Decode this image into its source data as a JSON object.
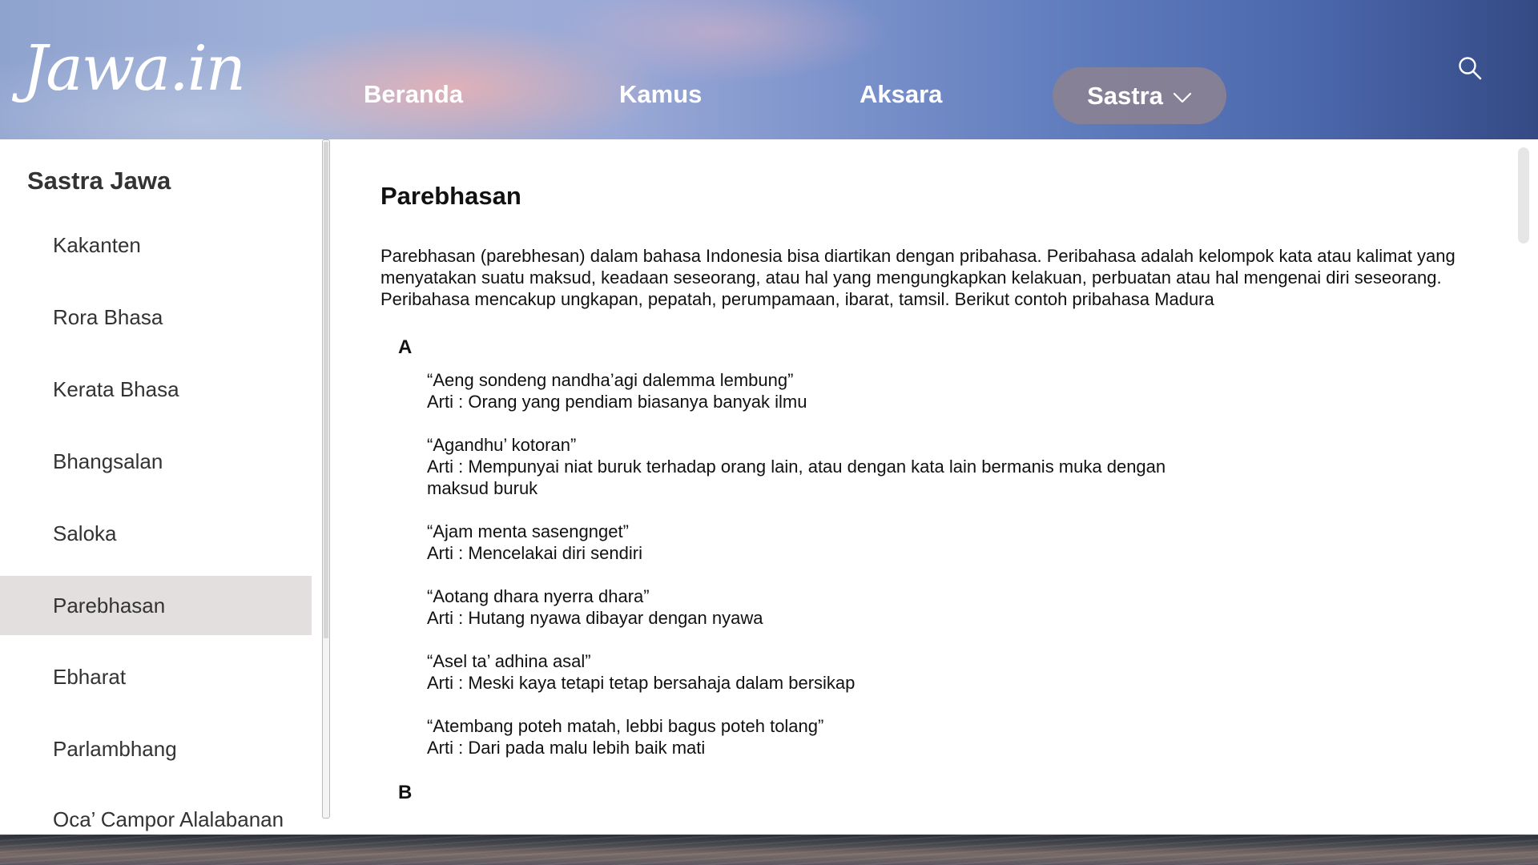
{
  "header": {
    "logo_text": "Jawa.in",
    "nav": {
      "beranda": "Beranda",
      "kamus": "Kamus",
      "aksara": "Aksara",
      "sastra": "Sastra"
    }
  },
  "sidebar": {
    "title": "Sastra Jawa",
    "items": [
      {
        "label": "Kakanten"
      },
      {
        "label": "Rora Bhasa"
      },
      {
        "label": "Kerata Bhasa"
      },
      {
        "label": "Bhangsalan"
      },
      {
        "label": "Saloka"
      },
      {
        "label": "Parebhasan"
      },
      {
        "label": "Ebharat"
      },
      {
        "label": "Parlambhang"
      },
      {
        "label": "Oca’ Campor Alalabanan"
      }
    ],
    "active_item": "Parebhasan"
  },
  "main": {
    "title": "Parebhasan",
    "intro": "Parebhasan (parebhesan) dalam bahasa Indonesia bisa diartikan dengan pribahasa. Peribahasa adalah kelompok kata atau kalimat yang menyatakan suatu maksud, keadaan seseorang, atau hal yang mengungkapkan kelakuan, perbuatan atau hal mengenai diri seseorang. Peribahasa mencakup ungkapan, pepatah, perumpamaan, ibarat, tamsil. Berikut contoh pribahasa Madura",
    "sections": [
      {
        "letter": "A",
        "entries": [
          {
            "phrase": "“Aeng sondeng nandha’agi dalemma lembung”",
            "meaning": "Arti : Orang yang pendiam biasanya banyak ilmu"
          },
          {
            "phrase": "“Agandhu’ kotoran”",
            "meaning": "Arti : Mempunyai niat buruk terhadap orang lain, atau dengan kata lain bermanis muka dengan maksud buruk"
          },
          {
            "phrase": "“Ajam menta sasengnget”",
            "meaning": "Arti : Mencelakai diri sendiri"
          },
          {
            "phrase": "“Aotang dhara nyerra dhara”",
            "meaning": "Arti : Hutang nyawa dibayar dengan nyawa"
          },
          {
            "phrase": "“Asel ta’ adhina asal”",
            "meaning": "Arti : Meski kaya tetapi tetap bersahaja dalam bersikap"
          },
          {
            "phrase": "“Atembang poteh matah, lebbi bagus poteh tolang”",
            "meaning": "Arti : Dari pada malu lebih baik mati"
          }
        ]
      },
      {
        "letter": "B",
        "entries": []
      }
    ]
  },
  "colors": {
    "header_left": "#9fb0d8",
    "header_right": "#344a85",
    "active_nav_pill": "#8c8291",
    "active_sidebar_bg": "#e3dfde"
  }
}
